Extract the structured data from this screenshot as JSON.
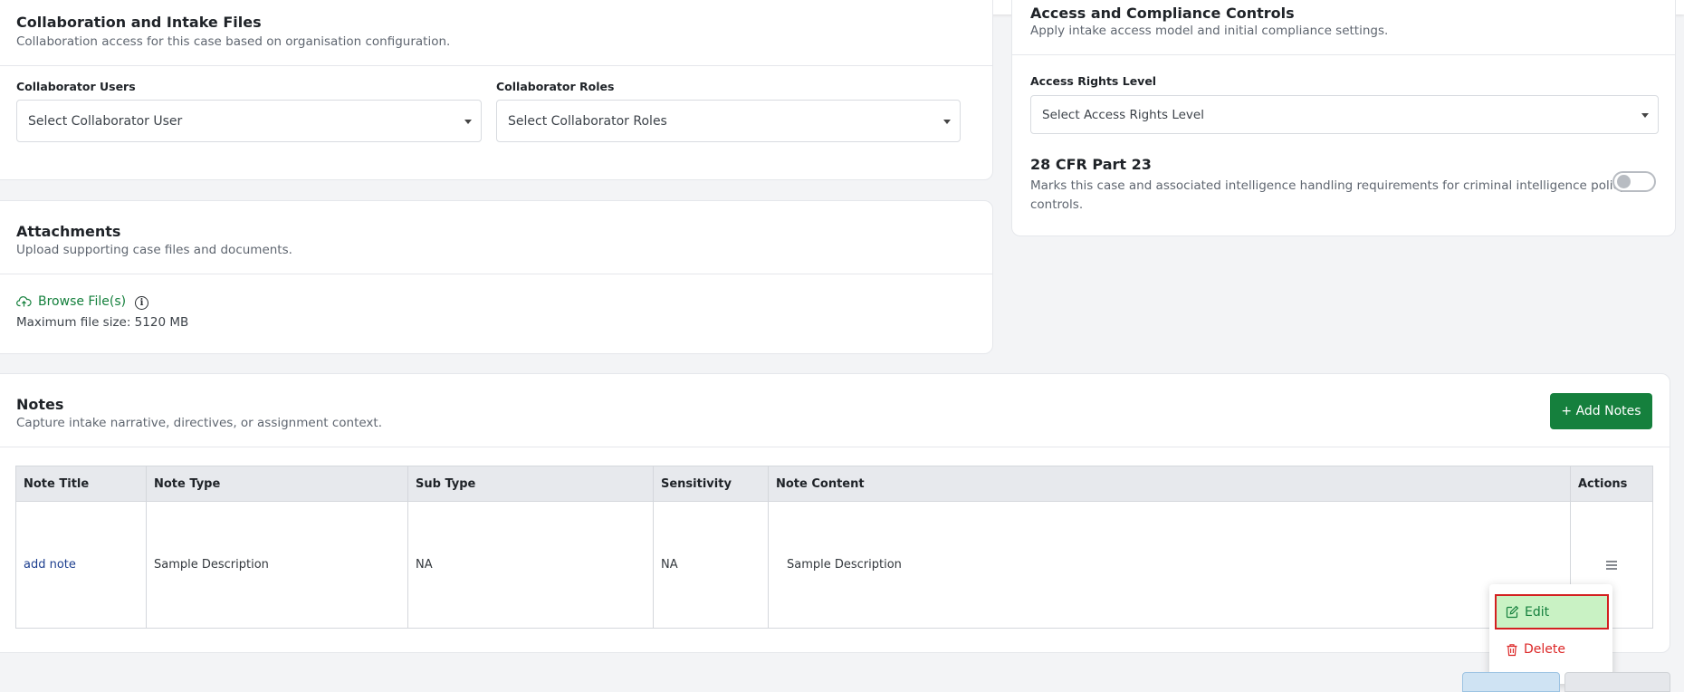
{
  "colors": {
    "accent": "#15803d",
    "link": "#1d3f8f",
    "danger": "#dc2626",
    "highlight": "#c9f2c4",
    "highlight_border": "#d32020"
  },
  "collaboration": {
    "title": "Collaboration and Intake Files",
    "subtitle": "Collaboration access for this case based on organisation configuration.",
    "users_label": "Collaborator Users",
    "users_placeholder": "Select Collaborator User",
    "roles_label": "Collaborator Roles",
    "roles_placeholder": "Select Collaborator Roles"
  },
  "access": {
    "title": "Access and Compliance Controls",
    "subtitle": "Apply intake access model and initial compliance settings.",
    "rights_label": "Access Rights Level",
    "rights_placeholder": "Select Access Rights Level",
    "cfr_title": "28 CFR Part 23",
    "cfr_desc_line1": "Marks this case and associated intelligence handling requirements for criminal intelligence policy",
    "cfr_desc_line2": "controls.",
    "cfr_enabled": false
  },
  "attachments": {
    "title": "Attachments",
    "subtitle": "Upload supporting case files and documents.",
    "browse_label": "Browse File(s)",
    "max_size": "Maximum file size: 5120 MB"
  },
  "notes": {
    "title": "Notes",
    "subtitle": "Capture intake narrative, directives, or assignment context.",
    "add_button": "+ Add Notes",
    "columns": [
      "Note Title",
      "Note Type",
      "Sub Type",
      "Sensitivity",
      "Note Content",
      "Actions"
    ],
    "rows": [
      {
        "title": "add note",
        "type": "Sample Description",
        "sub_type": "NA",
        "sensitivity": "NA",
        "content": "Sample Description"
      }
    ]
  },
  "actions_menu": {
    "edit": "Edit",
    "delete": "Delete"
  }
}
